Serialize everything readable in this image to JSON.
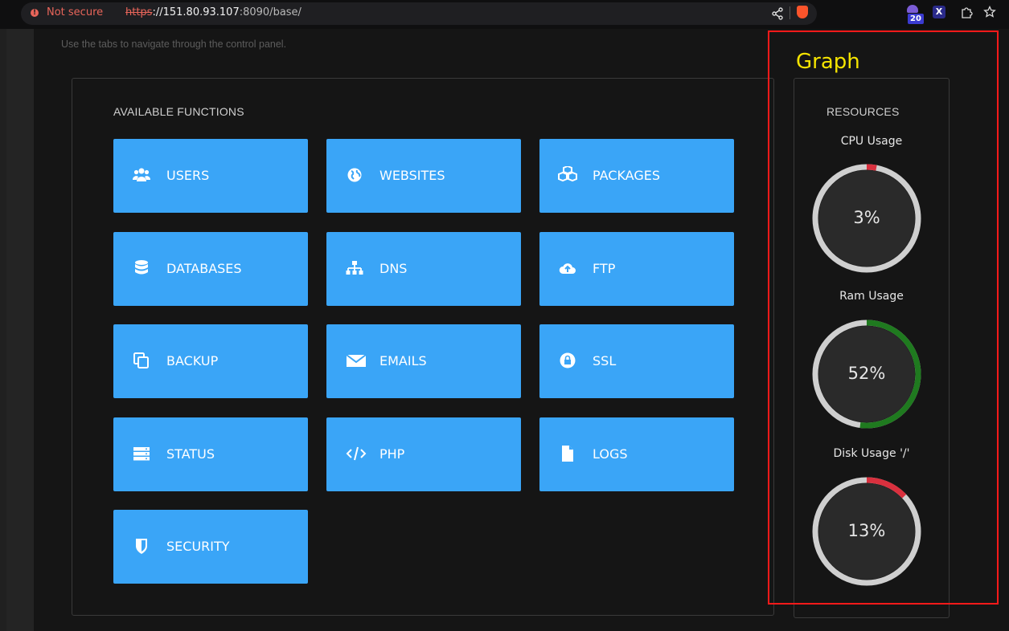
{
  "browser": {
    "not_secure": "Not secure",
    "url_scheme": "https",
    "url_host": "://151.80.93.107",
    "url_path": ":8090/base/",
    "extension_badge": "20",
    "extension_x": "X"
  },
  "page": {
    "subtitle": "Use the tabs to navigate through the control panel."
  },
  "functions": {
    "title": "AVAILABLE FUNCTIONS",
    "items": [
      {
        "label": "USERS",
        "icon": "users-icon"
      },
      {
        "label": "WEBSITES",
        "icon": "globe-icon"
      },
      {
        "label": "PACKAGES",
        "icon": "cubes-icon"
      },
      {
        "label": "DATABASES",
        "icon": "database-icon"
      },
      {
        "label": "DNS",
        "icon": "sitemap-icon"
      },
      {
        "label": "FTP",
        "icon": "cloud-upload-icon"
      },
      {
        "label": "BACKUP",
        "icon": "copy-icon"
      },
      {
        "label": "EMAILS",
        "icon": "envelope-icon"
      },
      {
        "label": "SSL",
        "icon": "lock-icon"
      },
      {
        "label": "STATUS",
        "icon": "server-icon"
      },
      {
        "label": "PHP",
        "icon": "code-icon"
      },
      {
        "label": "LOGS",
        "icon": "file-icon"
      },
      {
        "label": "SECURITY",
        "icon": "shield-icon"
      }
    ]
  },
  "resources": {
    "title": "RESOURCES",
    "gauges": [
      {
        "label": "CPU Usage",
        "value_text": "3%",
        "value": 3,
        "color": "#d9303e"
      },
      {
        "label": "Ram Usage",
        "value_text": "52%",
        "value": 52,
        "color": "#1f7a1f"
      },
      {
        "label": "Disk Usage '/'",
        "value_text": "13%",
        "value": 13,
        "color": "#d9303e"
      }
    ]
  },
  "annotation": {
    "label": "Graph"
  },
  "colors": {
    "button": "#3aa5f7",
    "background": "#151515",
    "gauge_track": "#cfcfcf",
    "annotation": "#ff1a1a",
    "annotation_text": "#f5e400"
  }
}
